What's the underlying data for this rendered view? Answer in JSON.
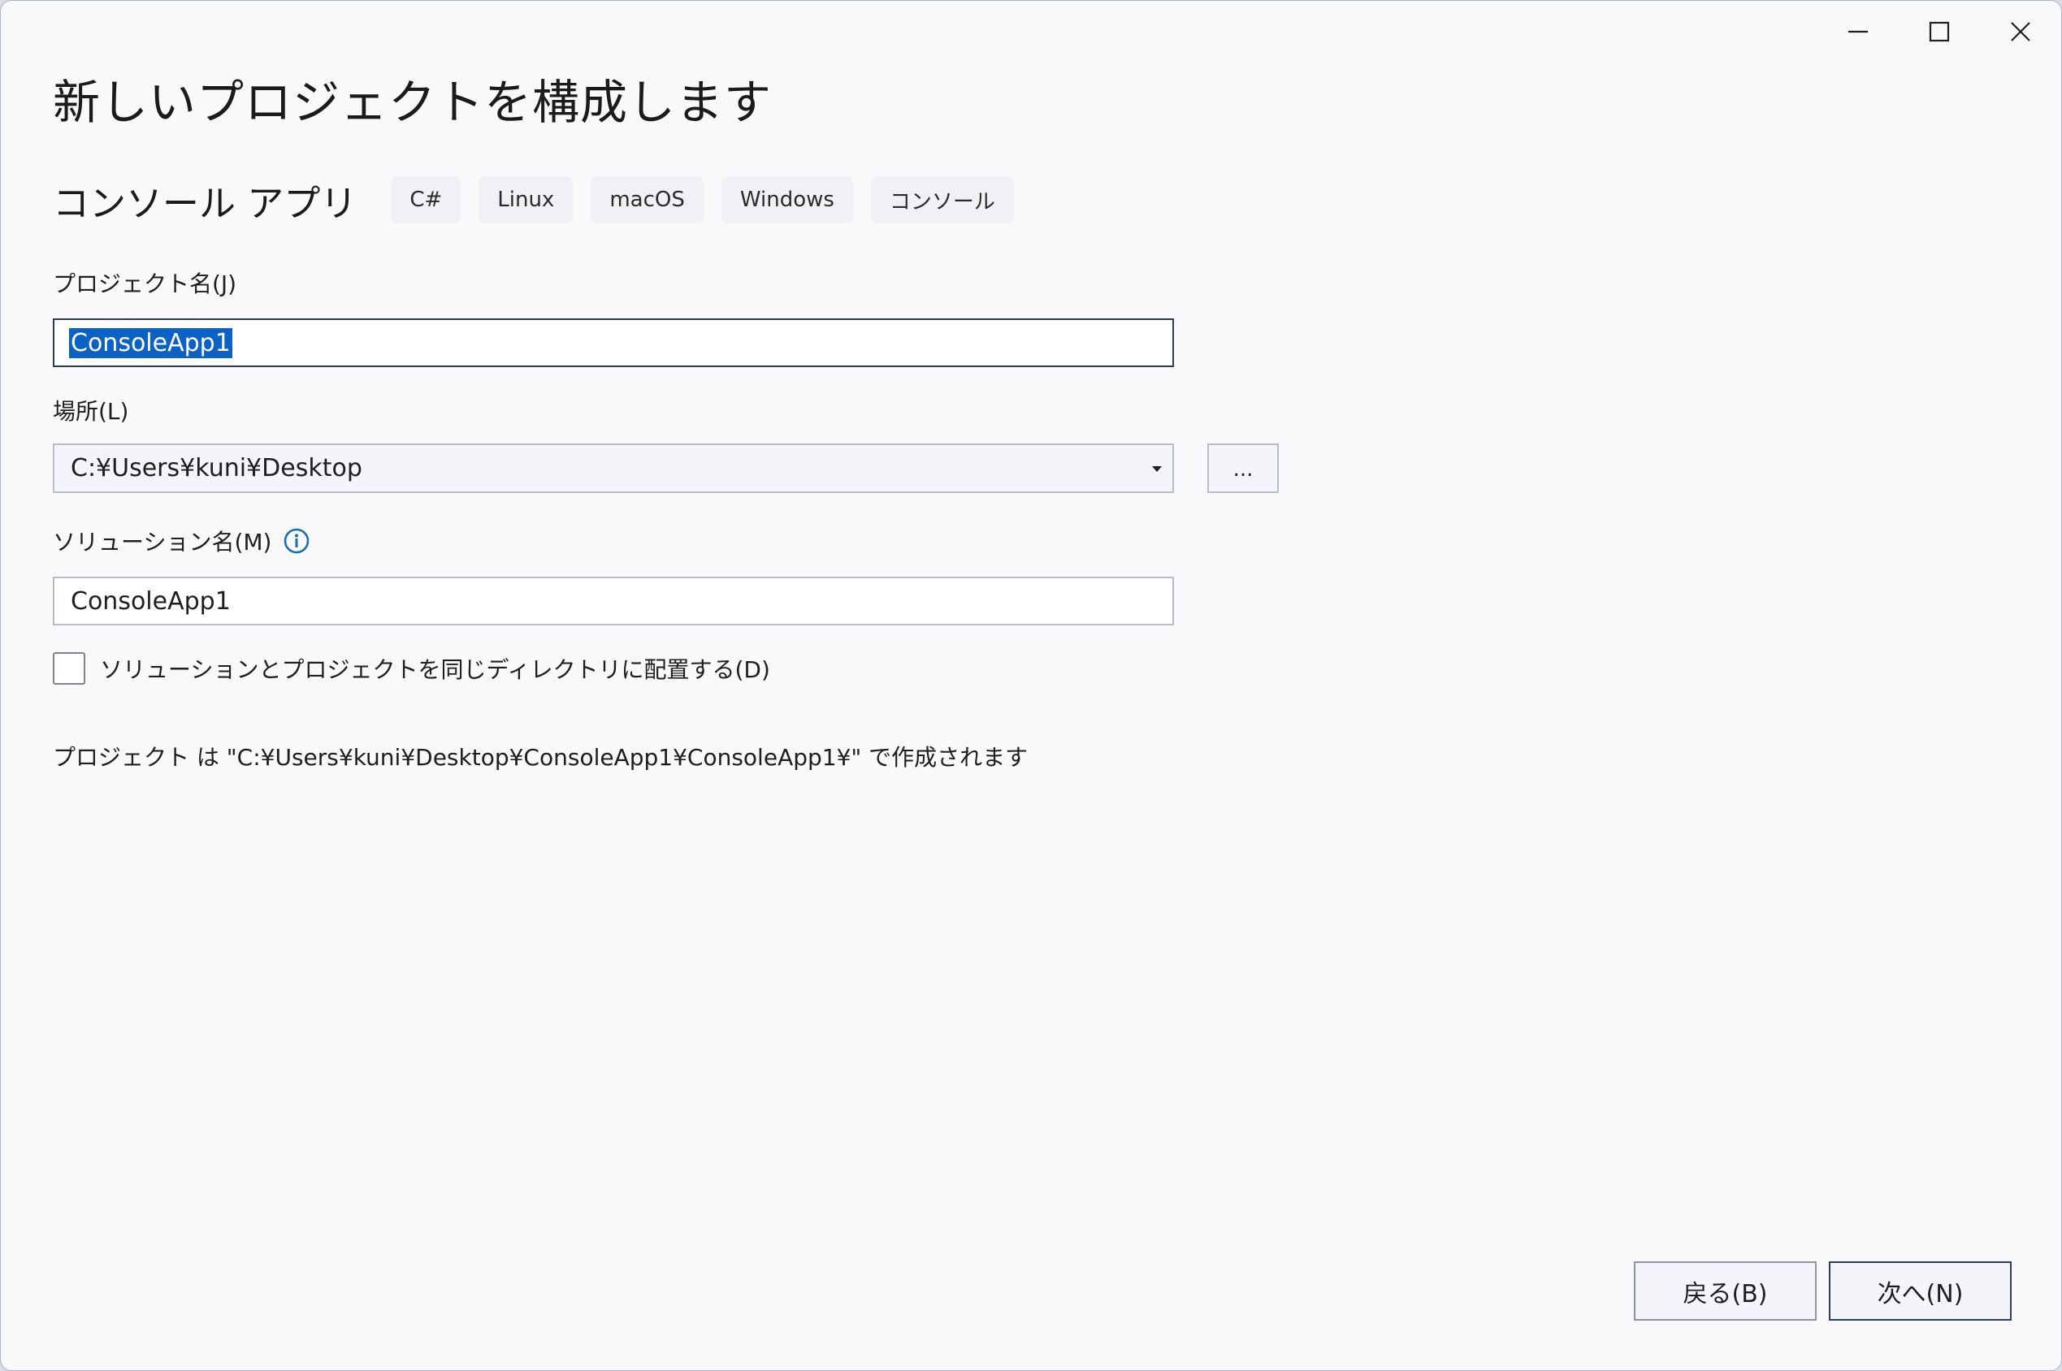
{
  "window": {
    "title": "新しいプロジェクトを構成します",
    "controls": {
      "minimize": "minimize-icon",
      "maximize": "maximize-icon",
      "close": "close-icon"
    }
  },
  "template": {
    "name": "コンソール アプリ",
    "tags": [
      "C#",
      "Linux",
      "macOS",
      "Windows",
      "コンソール"
    ]
  },
  "form": {
    "project_name": {
      "label": "プロジェクト名(J)",
      "value": "ConsoleApp1"
    },
    "location": {
      "label": "場所(L)",
      "value": "C:¥Users¥kuni¥Desktop",
      "browse_label": "..."
    },
    "solution_name": {
      "label": "ソリューション名(M)",
      "value": "ConsoleApp1",
      "info_icon": "info-icon"
    },
    "same_directory": {
      "label": "ソリューションとプロジェクトを同じディレクトリに配置する(D)",
      "checked": false
    },
    "path_note": "プロジェクト は \"C:¥Users¥kuni¥Desktop¥ConsoleApp1¥ConsoleApp1¥\" で作成されます"
  },
  "footer": {
    "back_label": "戻る(B)",
    "next_label": "次へ(N)"
  },
  "colors": {
    "accent": "#0b62c4",
    "info": "#1a6fb0",
    "window_bg": "#f9f9fb"
  }
}
